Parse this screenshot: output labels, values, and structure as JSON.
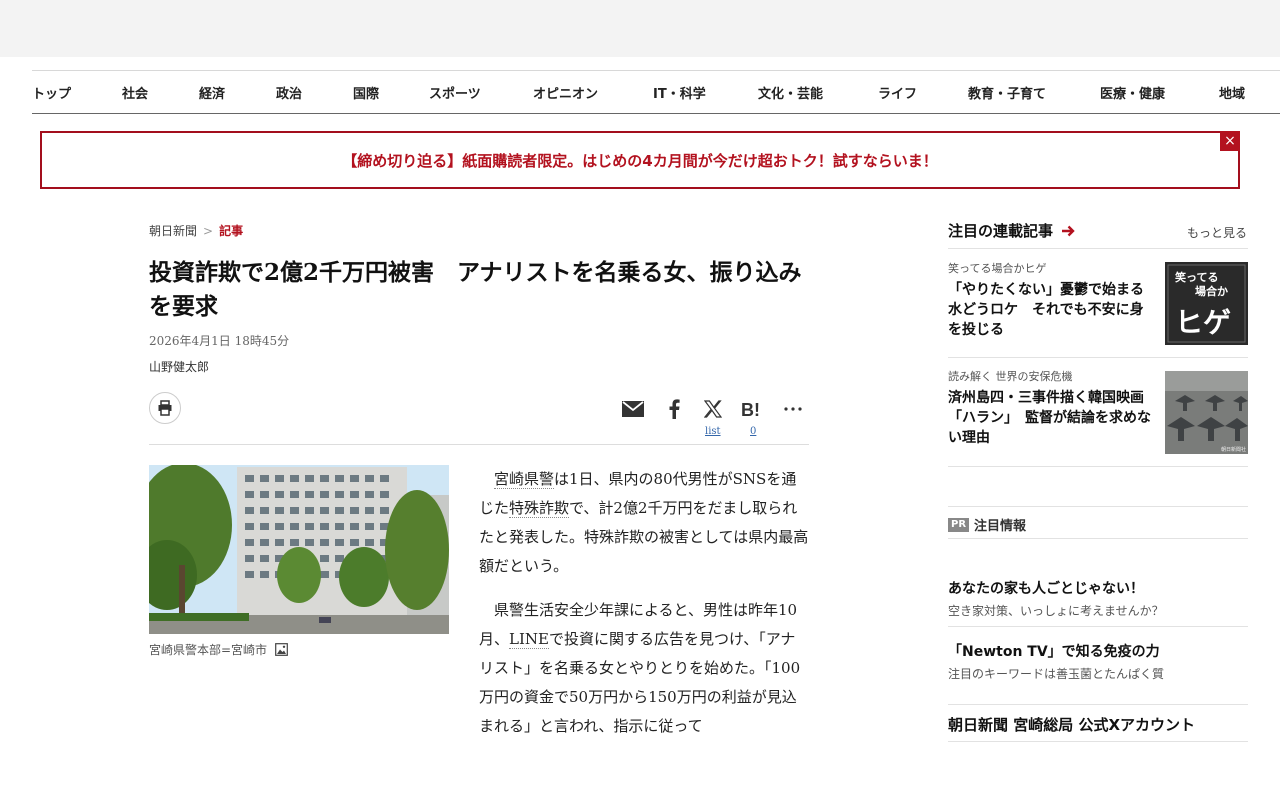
{
  "nav": [
    "トップ",
    "社会",
    "経済",
    "政治",
    "国際",
    "スポーツ",
    "オピニオン",
    "IT・科学",
    "文化・芸能",
    "ライフ",
    "教育・子育て",
    "医療・健康",
    "地域"
  ],
  "banner": {
    "text": "【締め切り迫る】紙面購読者限定。はじめの4カ月間が今だけ超おトク！試すならいま！",
    "close": "×"
  },
  "breadcrumb": {
    "home": "朝日新聞",
    "separator": ">",
    "current": "記事"
  },
  "article": {
    "title": "投資詐欺で2億2千万円被害　アナリストを名乗る女、振り込みを要求",
    "date": "2026年4月1日 18時45分",
    "author": "山野健太郎",
    "share": {
      "x_label": "list",
      "hatena_count": "0"
    },
    "photo_caption": "宮崎県警本部=宮崎市",
    "paragraphs": [
      {
        "a": "宮崎県警",
        "b": "は1日、県内の80代男性がSNSを通じた",
        "c": "特殊詐欺",
        "d": "で、計2億2千万円をだまし取られたと発表した。特殊詐欺の被害としては県内最高額だという。"
      },
      {
        "a": "県警生活安全少年課によると、男性は昨年10月、",
        "b": "LINE",
        "c": "で投資に関する広告を見つけ、「アナリスト」を名乗る女とやりとりを始めた。「100万円の資金で50万円から150万円の利益が見込まれる」と言われ、指示に従って"
      }
    ]
  },
  "sidebar": {
    "series_heading": "注目の連載記事",
    "more": "もっと見る",
    "series": [
      {
        "kicker": "笑ってる場合かヒゲ",
        "title": "「やりたくない」憂鬱で始まる水どうロケ　それでも不安に身を投じる",
        "thumb_text_top": "笑ってる",
        "thumb_text_mid": "場合か",
        "thumb_text_big": "ヒゲ"
      },
      {
        "kicker": "読み解く 世界の安保危機",
        "title": "済州島四・三事件描く韓国映画「ハラン」　監督が結論を求めない理由",
        "thumb_credit": "朝日新聞社"
      }
    ],
    "pr_badge": "PR",
    "pr_heading": "注目情報",
    "pr_items": [
      {
        "title": "あなたの家も人ごとじゃない！",
        "sub": "空き家対策、いっしょに考えませんか？"
      },
      {
        "title": "「Newton TV」で知る免疫の力",
        "sub": "注目のキーワードは善玉菌とたんぱく質"
      }
    ],
    "official": "朝日新聞 宮崎総局 公式Xアカウント"
  },
  "colors": {
    "accent": "#b3121f",
    "link": "#3366aa"
  },
  "icons": [
    "printer-icon",
    "mail-icon",
    "facebook-icon",
    "x-icon",
    "hatena-icon",
    "more-icon",
    "arrow-right-icon",
    "image-icon"
  ]
}
